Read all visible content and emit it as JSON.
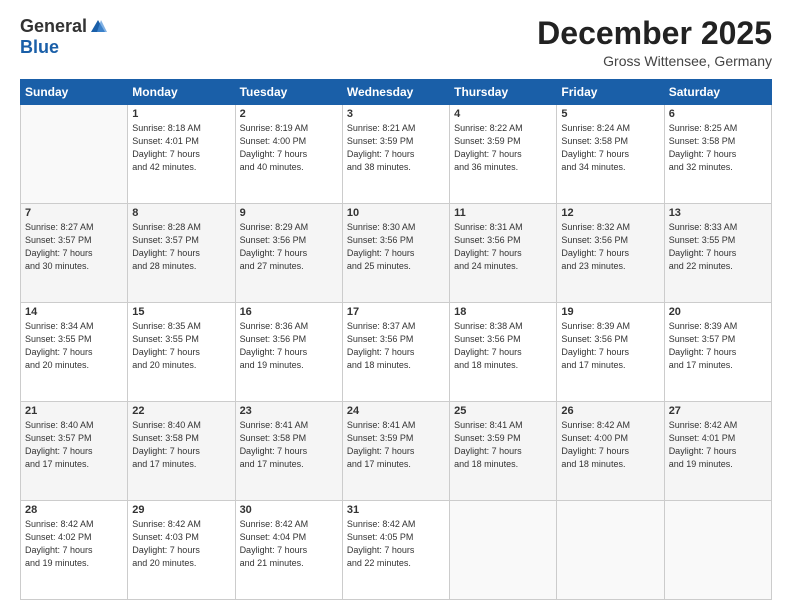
{
  "header": {
    "logo_general": "General",
    "logo_blue": "Blue",
    "month_title": "December 2025",
    "subtitle": "Gross Wittensee, Germany"
  },
  "days_of_week": [
    "Sunday",
    "Monday",
    "Tuesday",
    "Wednesday",
    "Thursday",
    "Friday",
    "Saturday"
  ],
  "weeks": [
    [
      {
        "day": "",
        "info": ""
      },
      {
        "day": "1",
        "info": "Sunrise: 8:18 AM\nSunset: 4:01 PM\nDaylight: 7 hours\nand 42 minutes."
      },
      {
        "day": "2",
        "info": "Sunrise: 8:19 AM\nSunset: 4:00 PM\nDaylight: 7 hours\nand 40 minutes."
      },
      {
        "day": "3",
        "info": "Sunrise: 8:21 AM\nSunset: 3:59 PM\nDaylight: 7 hours\nand 38 minutes."
      },
      {
        "day": "4",
        "info": "Sunrise: 8:22 AM\nSunset: 3:59 PM\nDaylight: 7 hours\nand 36 minutes."
      },
      {
        "day": "5",
        "info": "Sunrise: 8:24 AM\nSunset: 3:58 PM\nDaylight: 7 hours\nand 34 minutes."
      },
      {
        "day": "6",
        "info": "Sunrise: 8:25 AM\nSunset: 3:58 PM\nDaylight: 7 hours\nand 32 minutes."
      }
    ],
    [
      {
        "day": "7",
        "info": "Sunrise: 8:27 AM\nSunset: 3:57 PM\nDaylight: 7 hours\nand 30 minutes."
      },
      {
        "day": "8",
        "info": "Sunrise: 8:28 AM\nSunset: 3:57 PM\nDaylight: 7 hours\nand 28 minutes."
      },
      {
        "day": "9",
        "info": "Sunrise: 8:29 AM\nSunset: 3:56 PM\nDaylight: 7 hours\nand 27 minutes."
      },
      {
        "day": "10",
        "info": "Sunrise: 8:30 AM\nSunset: 3:56 PM\nDaylight: 7 hours\nand 25 minutes."
      },
      {
        "day": "11",
        "info": "Sunrise: 8:31 AM\nSunset: 3:56 PM\nDaylight: 7 hours\nand 24 minutes."
      },
      {
        "day": "12",
        "info": "Sunrise: 8:32 AM\nSunset: 3:56 PM\nDaylight: 7 hours\nand 23 minutes."
      },
      {
        "day": "13",
        "info": "Sunrise: 8:33 AM\nSunset: 3:55 PM\nDaylight: 7 hours\nand 22 minutes."
      }
    ],
    [
      {
        "day": "14",
        "info": "Sunrise: 8:34 AM\nSunset: 3:55 PM\nDaylight: 7 hours\nand 20 minutes."
      },
      {
        "day": "15",
        "info": "Sunrise: 8:35 AM\nSunset: 3:55 PM\nDaylight: 7 hours\nand 20 minutes."
      },
      {
        "day": "16",
        "info": "Sunrise: 8:36 AM\nSunset: 3:56 PM\nDaylight: 7 hours\nand 19 minutes."
      },
      {
        "day": "17",
        "info": "Sunrise: 8:37 AM\nSunset: 3:56 PM\nDaylight: 7 hours\nand 18 minutes."
      },
      {
        "day": "18",
        "info": "Sunrise: 8:38 AM\nSunset: 3:56 PM\nDaylight: 7 hours\nand 18 minutes."
      },
      {
        "day": "19",
        "info": "Sunrise: 8:39 AM\nSunset: 3:56 PM\nDaylight: 7 hours\nand 17 minutes."
      },
      {
        "day": "20",
        "info": "Sunrise: 8:39 AM\nSunset: 3:57 PM\nDaylight: 7 hours\nand 17 minutes."
      }
    ],
    [
      {
        "day": "21",
        "info": "Sunrise: 8:40 AM\nSunset: 3:57 PM\nDaylight: 7 hours\nand 17 minutes."
      },
      {
        "day": "22",
        "info": "Sunrise: 8:40 AM\nSunset: 3:58 PM\nDaylight: 7 hours\nand 17 minutes."
      },
      {
        "day": "23",
        "info": "Sunrise: 8:41 AM\nSunset: 3:58 PM\nDaylight: 7 hours\nand 17 minutes."
      },
      {
        "day": "24",
        "info": "Sunrise: 8:41 AM\nSunset: 3:59 PM\nDaylight: 7 hours\nand 17 minutes."
      },
      {
        "day": "25",
        "info": "Sunrise: 8:41 AM\nSunset: 3:59 PM\nDaylight: 7 hours\nand 18 minutes."
      },
      {
        "day": "26",
        "info": "Sunrise: 8:42 AM\nSunset: 4:00 PM\nDaylight: 7 hours\nand 18 minutes."
      },
      {
        "day": "27",
        "info": "Sunrise: 8:42 AM\nSunset: 4:01 PM\nDaylight: 7 hours\nand 19 minutes."
      }
    ],
    [
      {
        "day": "28",
        "info": "Sunrise: 8:42 AM\nSunset: 4:02 PM\nDaylight: 7 hours\nand 19 minutes."
      },
      {
        "day": "29",
        "info": "Sunrise: 8:42 AM\nSunset: 4:03 PM\nDaylight: 7 hours\nand 20 minutes."
      },
      {
        "day": "30",
        "info": "Sunrise: 8:42 AM\nSunset: 4:04 PM\nDaylight: 7 hours\nand 21 minutes."
      },
      {
        "day": "31",
        "info": "Sunrise: 8:42 AM\nSunset: 4:05 PM\nDaylight: 7 hours\nand 22 minutes."
      },
      {
        "day": "",
        "info": ""
      },
      {
        "day": "",
        "info": ""
      },
      {
        "day": "",
        "info": ""
      }
    ]
  ]
}
